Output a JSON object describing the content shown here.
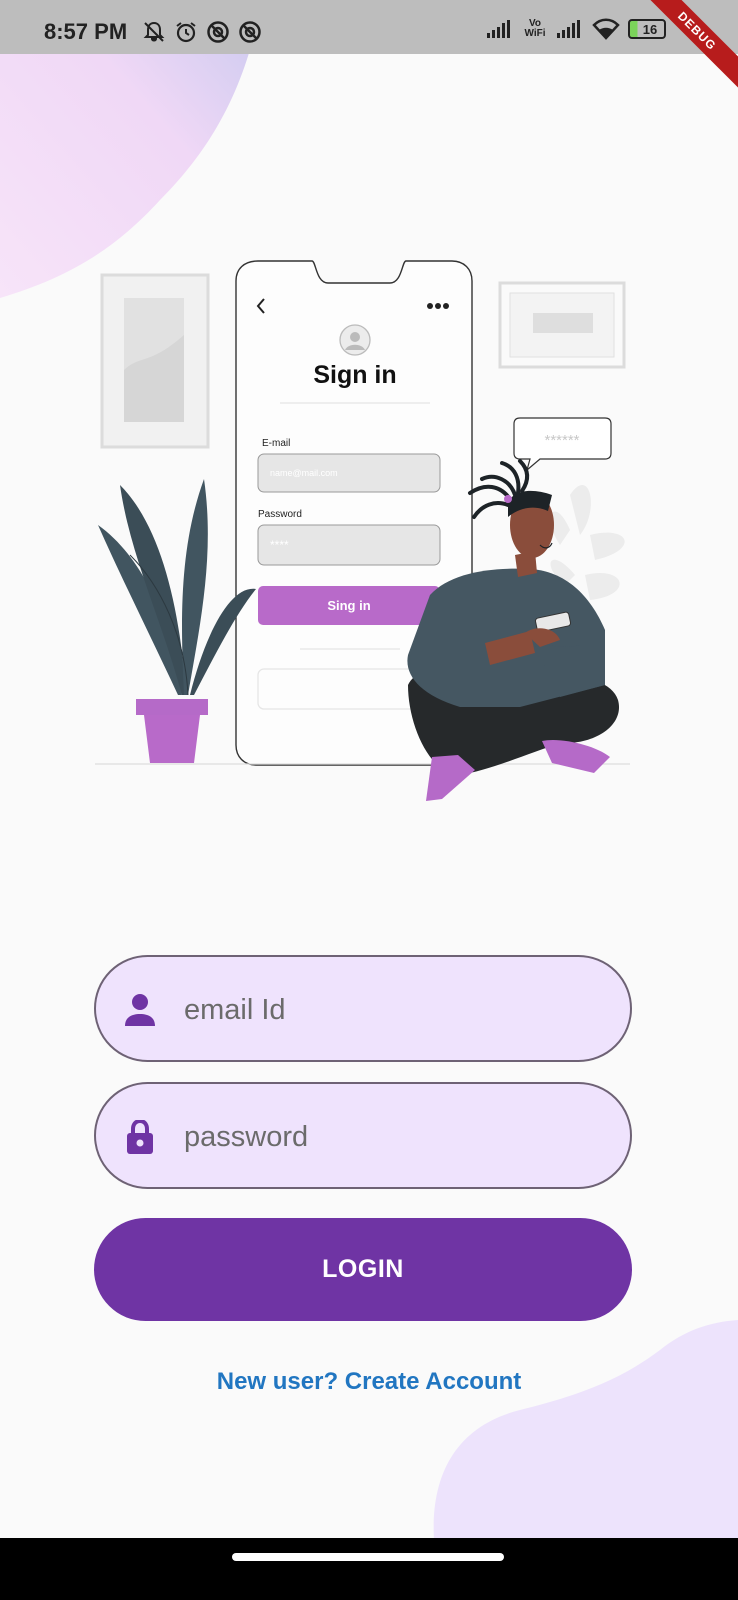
{
  "status_bar": {
    "time": "8:57 PM",
    "left_icons": [
      "muted-bell-icon",
      "alarm-icon",
      "sync-icon",
      "sync-icon"
    ],
    "network_label": "Vo WiFi",
    "battery_level": "16"
  },
  "debug_banner": "DEBUG",
  "illustration": {
    "name": "sign-in-illustration",
    "phone_title": "Sign in",
    "email_label": "E-mail",
    "email_placeholder": "name@mail.com",
    "password_label": "Password",
    "password_mask": "****",
    "button_label": "Sing in",
    "speech_bubble": "******"
  },
  "form": {
    "email_placeholder": "email Id",
    "password_placeholder": "password",
    "login_label": "LOGIN",
    "create_account_link": "New user? Create Account"
  },
  "colors": {
    "primary": "#6f34a4",
    "field_background": "#efe3fd",
    "link": "#2176c1",
    "blob": "#ede3fc"
  }
}
